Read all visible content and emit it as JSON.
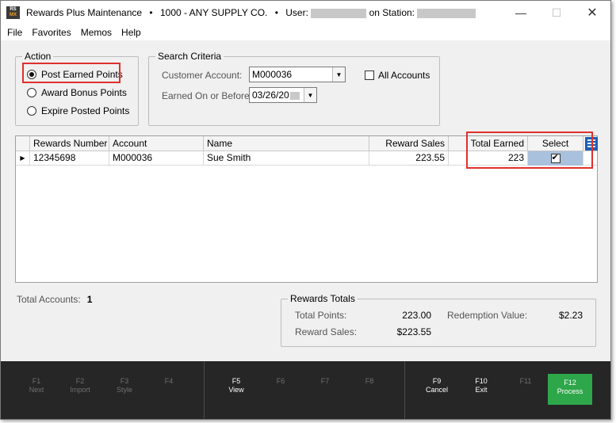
{
  "titlebar": {
    "app_name": "Rewards Plus Maintenance",
    "separator": "•",
    "company": "1000 - ANY SUPPLY CO.",
    "user_label": "User:",
    "station_label": "on Station:",
    "logo_text_top": "RS",
    "logo_text_bottom": "MX"
  },
  "menu": [
    "File",
    "Favorites",
    "Memos",
    "Help"
  ],
  "action": {
    "legend": "Action",
    "options": [
      {
        "label": "Post Earned Points",
        "selected": true
      },
      {
        "label": "Award Bonus Points",
        "selected": false
      },
      {
        "label": "Expire Posted Points",
        "selected": false
      }
    ]
  },
  "search": {
    "legend": "Search Criteria",
    "customer_account_label": "Customer Account:",
    "customer_account_value": "M000036",
    "all_accounts_label": "All Accounts",
    "all_accounts_checked": false,
    "earned_on_label": "Earned On or Before:",
    "earned_on_value": "03/26/20"
  },
  "grid": {
    "columns": [
      "Rewards Number",
      "Account",
      "Name",
      "Reward Sales",
      "Total Earned",
      "Select"
    ],
    "rows": [
      {
        "rewards_number": "12345698",
        "account": "M000036",
        "name": "Sue Smith",
        "reward_sales": "223.55",
        "total_earned": "223",
        "selected": true
      }
    ]
  },
  "summary": {
    "total_accounts_label": "Total Accounts:",
    "total_accounts_value": "1"
  },
  "rewards_totals": {
    "legend": "Rewards Totals",
    "total_points_label": "Total Points:",
    "total_points_value": "223.00",
    "redemption_value_label": "Redemption Value:",
    "redemption_value_value": "$2.23",
    "reward_sales_label": "Reward Sales:",
    "reward_sales_value": "$223.55"
  },
  "fkeys": [
    {
      "key": "F1",
      "label": "Next"
    },
    {
      "key": "F2",
      "label": "Import"
    },
    {
      "key": "F3",
      "label": "Style"
    },
    {
      "key": "F4",
      "label": ""
    },
    {
      "key": "F5",
      "label": "View"
    },
    {
      "key": "F6",
      "label": ""
    },
    {
      "key": "F7",
      "label": ""
    },
    {
      "key": "F8",
      "label": ""
    },
    {
      "key": "F9",
      "label": "Cancel"
    },
    {
      "key": "F10",
      "label": "Exit"
    },
    {
      "key": "F11",
      "label": ""
    },
    {
      "key": "F12",
      "label": "Process"
    }
  ],
  "colors": {
    "highlight": "#e0302c",
    "process_button": "#2ea74a",
    "fkey_bar": "#262626",
    "row_select": "#a9c1dc"
  }
}
